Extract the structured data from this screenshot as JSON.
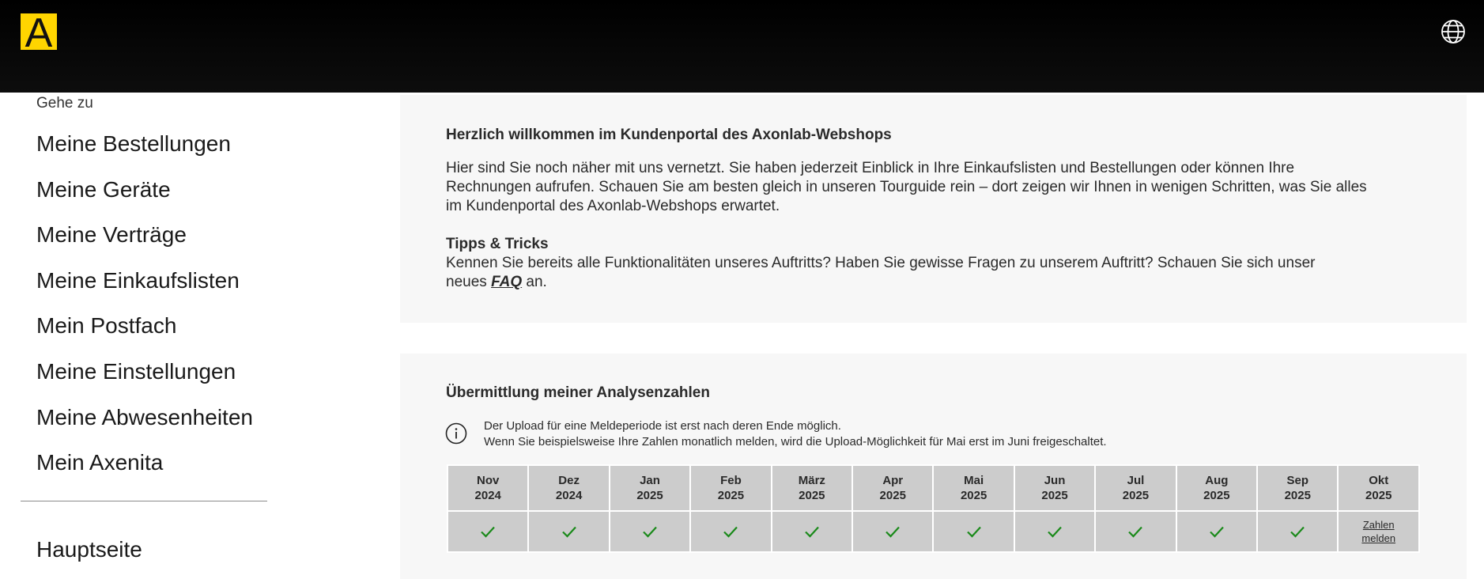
{
  "header": {
    "logo_letter": "A",
    "language_icon": "globe-icon",
    "brand_color": "#ffd500"
  },
  "sidebar": {
    "goto_label": "Gehe zu",
    "items": [
      {
        "label": "Meine Bestellungen"
      },
      {
        "label": "Meine Geräte"
      },
      {
        "label": "Meine Verträge"
      },
      {
        "label": "Meine Einkaufslisten"
      },
      {
        "label": "Mein Postfach"
      },
      {
        "label": "Meine Einstellungen"
      },
      {
        "label": "Meine Abwesenheiten"
      },
      {
        "label": "Mein Axenita"
      }
    ],
    "home_label": "Hauptseite"
  },
  "welcome": {
    "title": "Herzlich willkommen im Kundenportal des Axonlab-Webshops",
    "intro_line1": "Hier sind Sie noch näher mit uns vernetzt. Sie haben jederzeit Einblick in Ihre Einkaufslisten und Bestellungen oder können Ihre",
    "intro_line2": "Rechnungen aufrufen. Schauen Sie am besten gleich in unseren Tourguide rein – dort zeigen wir Ihnen in wenigen Schritten, was Sie alles",
    "intro_line3": "im Kundenportal des Axonlab-Webshops erwartet.",
    "tips_title": "Tipps & Tricks",
    "tips_line1": "Kennen Sie bereits alle Funktionalitäten unseres Auftritts? Haben Sie gewisse Fragen zu unserem Auftritt? Schauen Sie sich unser",
    "tips_prefix": "neues",
    "faq_link": "FAQ",
    "tips_suffix": "an."
  },
  "analysis": {
    "title": "Übermittlung meiner Analysenzahlen",
    "info_icon": "info-icon",
    "info_line1": "Der Upload für eine Meldeperiode ist erst nach deren Ende möglich.",
    "info_line2": "Wenn Sie beispielsweise Ihre Zahlen monatlich melden, wird die Upload-Möglichkeit für Mai erst im Juni freigeschaltet.",
    "check_color": "#1a8a1a",
    "months": [
      {
        "month": "Nov",
        "year": "2024",
        "status": "done"
      },
      {
        "month": "Dez",
        "year": "2024",
        "status": "done"
      },
      {
        "month": "Jan",
        "year": "2025",
        "status": "done"
      },
      {
        "month": "Feb",
        "year": "2025",
        "status": "done"
      },
      {
        "month": "März",
        "year": "2025",
        "status": "done"
      },
      {
        "month": "Apr",
        "year": "2025",
        "status": "done"
      },
      {
        "month": "Mai",
        "year": "2025",
        "status": "done"
      },
      {
        "month": "Jun",
        "year": "2025",
        "status": "done"
      },
      {
        "month": "Jul",
        "year": "2025",
        "status": "done"
      },
      {
        "month": "Aug",
        "year": "2025",
        "status": "done"
      },
      {
        "month": "Sep",
        "year": "2025",
        "status": "done"
      },
      {
        "month": "Okt",
        "year": "2025",
        "status": "open",
        "action_line1": "Zahlen",
        "action_line2": "melden"
      }
    ]
  }
}
